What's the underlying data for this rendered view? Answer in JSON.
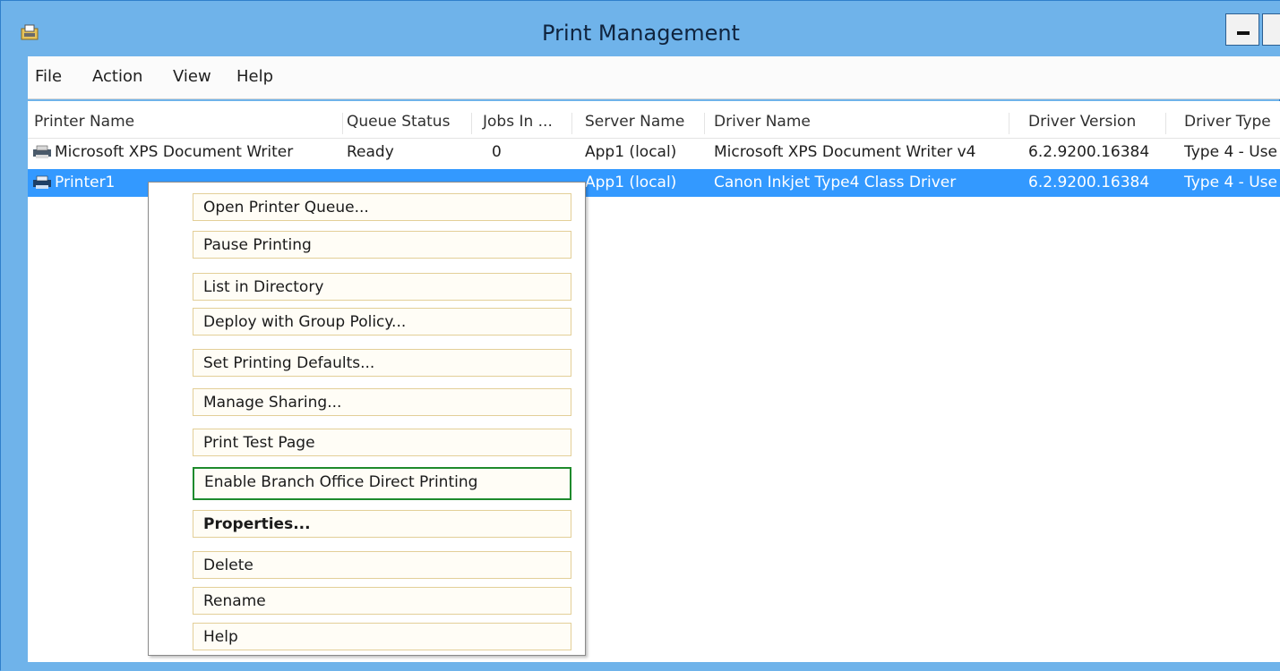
{
  "window": {
    "title": "Print Management",
    "icon": "printer-folder-icon"
  },
  "menubar": {
    "items": [
      "File",
      "Action",
      "View",
      "Help"
    ]
  },
  "table": {
    "columns": [
      "Printer Name",
      "Queue Status",
      "Jobs In ...",
      "Server Name",
      "Driver Name",
      "Driver Version",
      "Driver Type"
    ],
    "rows": [
      {
        "printer_name": "Microsoft XPS Document Writer",
        "queue_status": "Ready",
        "jobs_in": "0",
        "server_name": "App1 (local)",
        "driver_name": "Microsoft XPS Document Writer v4",
        "driver_version": "6.2.9200.16384",
        "driver_type": "Type 4 - Use",
        "selected": false
      },
      {
        "printer_name": "Printer1",
        "server_name": "App1 (local)",
        "driver_name": "Canon Inkjet Type4 Class Driver",
        "driver_version": "6.2.9200.16384",
        "driver_type": "Type 4 - Use",
        "selected": true
      }
    ]
  },
  "context_menu": {
    "items": [
      "Open Printer Queue...",
      "Pause Printing",
      "List in Directory",
      "Deploy with Group Policy...",
      "Set Printing Defaults...",
      "Manage Sharing...",
      "Print Test Page",
      "Enable Branch Office Direct Printing",
      "Properties...",
      "Delete",
      "Rename",
      "Help"
    ],
    "highlighted_item": "Enable Branch Office Direct Printing",
    "bold_item": "Properties..."
  },
  "colors": {
    "title_bar": "#6fb3ea",
    "selection": "#3399ff",
    "highlight_border": "#1e8a2c",
    "menu_item_border": "#e3cf98"
  }
}
